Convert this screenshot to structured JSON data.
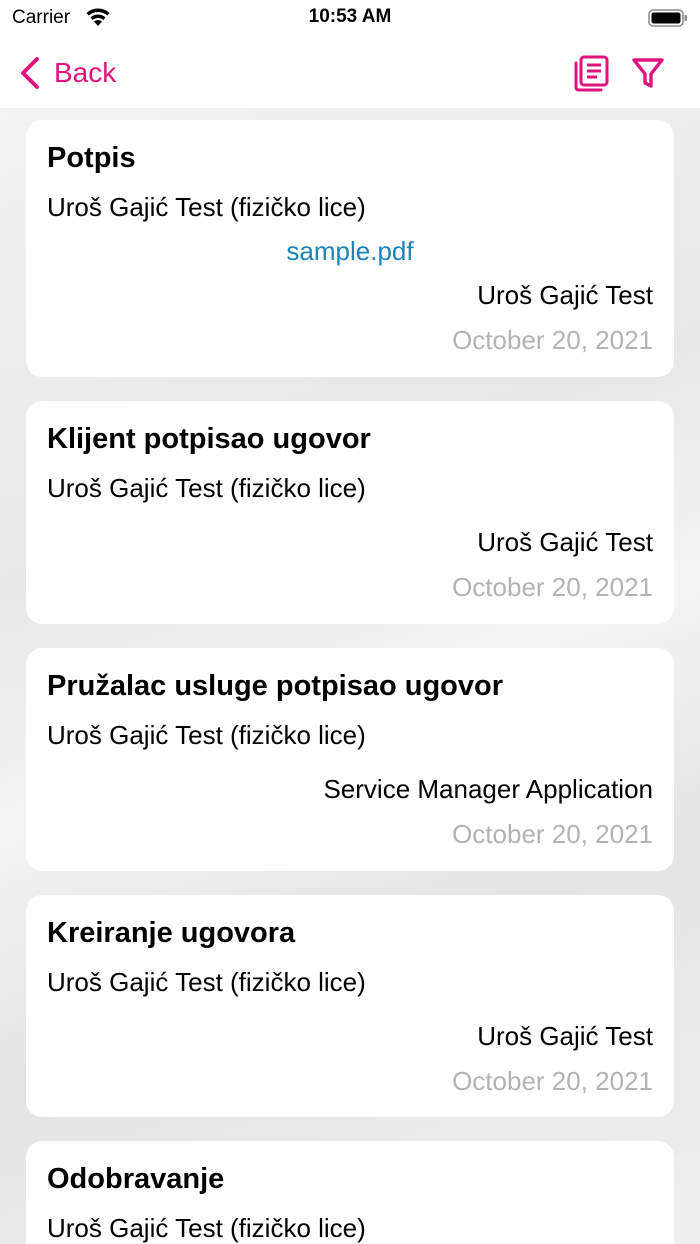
{
  "status_bar": {
    "carrier": "Carrier",
    "time": "10:53 AM"
  },
  "nav": {
    "back_label": "Back",
    "accent_color": "#e0137d",
    "icons": [
      "chevron-left-icon",
      "document-list-icon",
      "filter-icon"
    ]
  },
  "items": [
    {
      "title": "Potpis",
      "subtitle": "Uroš Gajić Test (fizičko lice)",
      "link": "sample.pdf",
      "author": "Uroš Gajić Test",
      "date": "October 20, 2021"
    },
    {
      "title": "Klijent potpisao ugovor",
      "subtitle": "Uroš Gajić Test (fizičko lice)",
      "author": "Uroš Gajić Test",
      "date": "October 20, 2021"
    },
    {
      "title": "Pružalac usluge potpisao ugovor",
      "subtitle": "Uroš Gajić Test (fizičko lice)",
      "author": "Service Manager Application",
      "date": "October 20, 2021"
    },
    {
      "title": "Kreiranje ugovora",
      "subtitle": "Uroš Gajić Test (fizičko lice)",
      "author": "Uroš Gajić Test",
      "date": "October 20, 2021"
    },
    {
      "title": "Odobravanje",
      "subtitle": "Uroš Gajić Test (fizičko lice)"
    }
  ]
}
